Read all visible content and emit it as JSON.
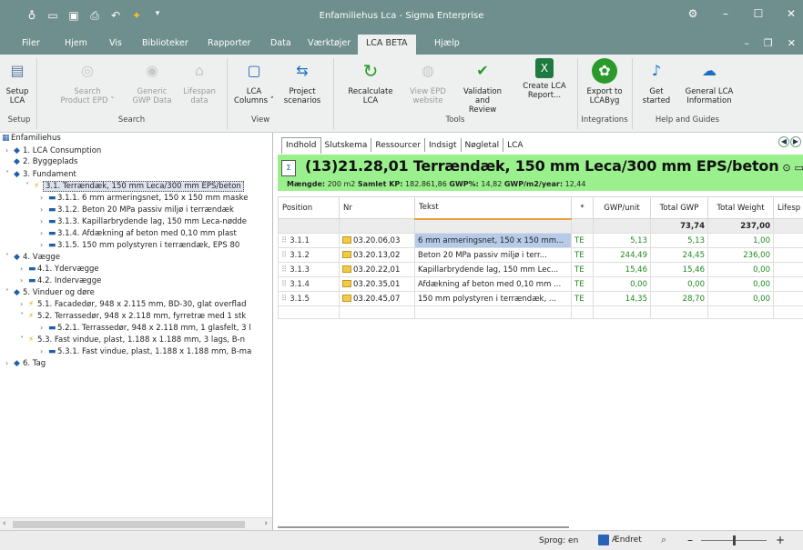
{
  "window": {
    "title": "Enfamiliehus Lca - Sigma Enterprise",
    "qat_icons": [
      "app-icon",
      "open-icon",
      "save-icon",
      "print-icon",
      "undo-icon",
      "magic-icon",
      "dropdown-icon"
    ],
    "controls": [
      "settings-icon",
      "minimize-icon",
      "maximize-icon",
      "close-icon"
    ]
  },
  "menu": {
    "tabs": [
      "Filer",
      "Hjem",
      "Vis",
      "Biblioteker",
      "Rapporter",
      "Data",
      "Værktøjer",
      "LCA BETA",
      "Hjælp"
    ],
    "active_tab": "LCA BETA"
  },
  "ribbon": {
    "buttons": [
      {
        "label1": "Setup",
        "label2": "LCA",
        "enabled": true
      },
      {
        "label1": "Search",
        "label2": "Product EPD ˅",
        "enabled": false
      },
      {
        "label1": "Generic",
        "label2": "GWP Data",
        "enabled": false
      },
      {
        "label1": "Lifespan",
        "label2": "data",
        "enabled": false
      },
      {
        "label1": "LCA",
        "label2": "Columns ˅",
        "enabled": true
      },
      {
        "label1": "Project",
        "label2": "scenarios",
        "enabled": true
      },
      {
        "label1": "Recalculate",
        "label2": "LCA",
        "enabled": true
      },
      {
        "label1": "View EPD",
        "label2": "website",
        "enabled": false
      },
      {
        "label1": "Validation",
        "label2": "and Review",
        "enabled": true
      },
      {
        "label1": "Create LCA",
        "label2": "Report...",
        "enabled": true
      },
      {
        "label1": "Export to",
        "label2": "LCAByg",
        "enabled": true
      },
      {
        "label1": "Get",
        "label2": "started",
        "enabled": true
      },
      {
        "label1": "General LCA",
        "label2": "Information",
        "enabled": true
      }
    ],
    "groups": [
      "Setup",
      "Search",
      "View",
      "Tools",
      "Integrations",
      "Help and Guides"
    ]
  },
  "tree": {
    "items": [
      {
        "label": "Enfamiliehus"
      },
      {
        "label": "1. LCA Consumption"
      },
      {
        "label": "2. Byggeplads"
      },
      {
        "label": "3. Fundament"
      },
      {
        "label": "3.1. Terrændæk, 150 mm Leca/300 mm EPS/beton"
      },
      {
        "label": "3.1.1. 6 mm armeringsnet, 150 x 150 mm maske"
      },
      {
        "label": "3.1.2. Beton 20 MPa passiv miljø i terrændæk"
      },
      {
        "label": "3.1.3. Kapillarbrydende lag, 150 mm Leca-nødde"
      },
      {
        "label": "3.1.4. Afdækning af beton med 0,10 mm plast"
      },
      {
        "label": "3.1.5. 150 mm polystyren i terrændæk, EPS 80"
      },
      {
        "label": "4. Vægge"
      },
      {
        "label": "4.1. Ydervægge"
      },
      {
        "label": "4.2. Indervægge"
      },
      {
        "label": "5. Vinduer og døre"
      },
      {
        "label": "5.1. Facadedør, 948 x 2.115 mm, BD-30, glat overflad"
      },
      {
        "label": "5.2. Terrassedør, 948 x 2.118 mm, fyrretræ med 1 stk"
      },
      {
        "label": "5.2.1. Terrassedør, 948 x 2.118 mm, 1 glasfelt, 3 l"
      },
      {
        "label": "5.3. Fast vindue, plast, 1.188 x 1.188 mm, 3 lags, B-n"
      },
      {
        "label": "5.3.1. Fast vindue, plast, 1.188 x 1.188 mm, B-ma"
      },
      {
        "label": "6. Tag"
      }
    ]
  },
  "content": {
    "tabs": [
      "Indhold",
      "Slutskema",
      "Ressourcer",
      "Indsigt",
      "Nøgletal",
      "LCA"
    ],
    "active_tab": "Indhold",
    "heading": "(13)21.28,01 Terrændæk, 150 mm Leca/300 mm EPS/beton",
    "summary": {
      "maengde_label": "Mængde:",
      "maengde_value": "200 m2",
      "kp_label": "Samlet KP:",
      "kp_value": "182.861,86",
      "gwp_pct_label": "GWP%:",
      "gwp_pct_value": "14,82",
      "gwp_m2_label": "GWP/m2/year:",
      "gwp_m2_value": "12,44"
    },
    "columns": [
      "Position",
      "Nr",
      "Tekst",
      "*",
      "GWP/unit",
      "Total GWP",
      "Total Weight",
      "Lifesp"
    ],
    "totals": {
      "total_gwp": "73,74",
      "total_weight": "237,00"
    },
    "rows": [
      {
        "position": "3.1.1",
        "nr": "03.20.06,03",
        "tekst": "6 mm armeringsnet, 150 x 150 mm...",
        "star": "TE",
        "gwp_unit": "5,13",
        "total_gwp": "5,13",
        "total_weight": "1,00"
      },
      {
        "position": "3.1.2",
        "nr": "03.20.13,02",
        "tekst": "Beton 20 MPa passiv miljø i terr...",
        "star": "TE",
        "gwp_unit": "244,49",
        "total_gwp": "24,45",
        "total_weight": "236,00"
      },
      {
        "position": "3.1.3",
        "nr": "03.20.22,01",
        "tekst": "Kapillarbrydende lag, 150 mm Lec...",
        "star": "TE",
        "gwp_unit": "15,46",
        "total_gwp": "15,46",
        "total_weight": "0,00"
      },
      {
        "position": "3.1.4",
        "nr": "03.20.35,01",
        "tekst": "Afdækning af beton med 0,10 mm ...",
        "star": "TE",
        "gwp_unit": "0,00",
        "total_gwp": "0,00",
        "total_weight": "0,00"
      },
      {
        "position": "3.1.5",
        "nr": "03.20.45,07",
        "tekst": "150 mm polystyren i terrændæk, ...",
        "star": "TE",
        "gwp_unit": "14,35",
        "total_gwp": "28,70",
        "total_weight": "0,00"
      }
    ]
  },
  "status": {
    "language": "Sprog: en",
    "changed": "Ændret"
  },
  "colors": {
    "titlebar": "#6e8f8d",
    "header_band": "#9af08c",
    "value_green": "#1f8a1f"
  }
}
